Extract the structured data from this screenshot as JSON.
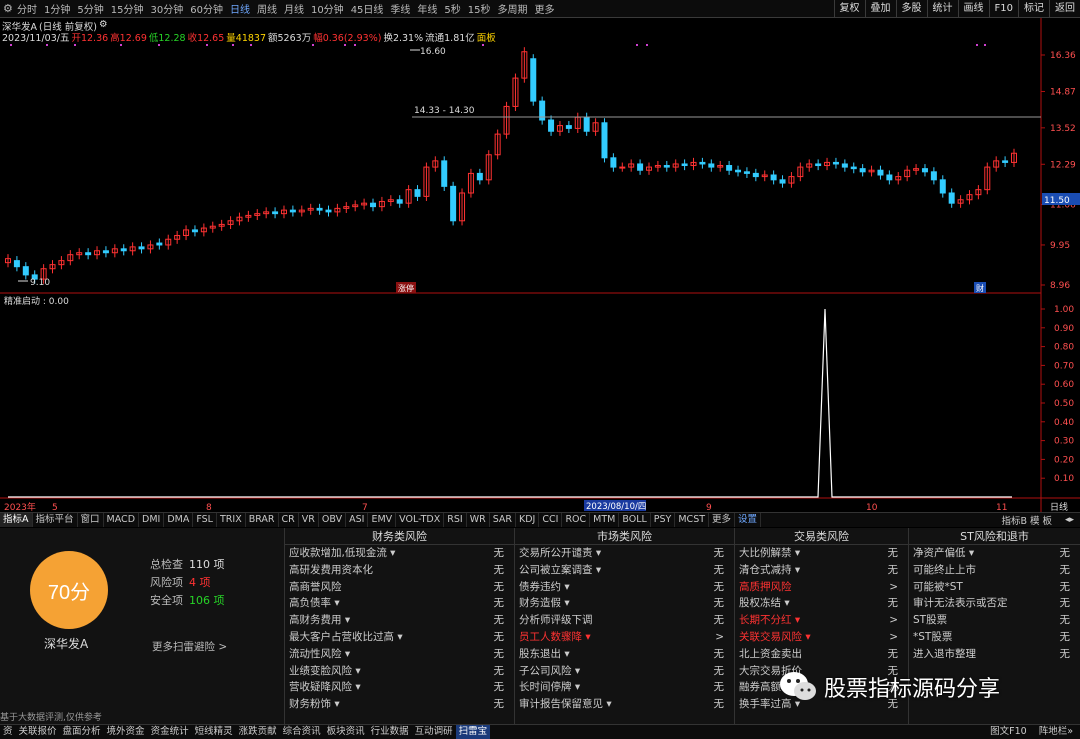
{
  "topbar": {
    "periods": [
      "分时",
      "1分钟",
      "5分钟",
      "15分钟",
      "30分钟",
      "60分钟",
      "日线",
      "周线",
      "月线",
      "10分钟",
      "45日线",
      "季线",
      "年线",
      "5秒",
      "15秒",
      "多周期",
      "更多"
    ],
    "active": "日线",
    "right_buttons": [
      "复权",
      "叠加",
      "多股",
      "统计",
      "画线",
      "F10",
      "标记",
      "返回"
    ]
  },
  "info": {
    "stock": "深华发A",
    "mode": "(日线 前复权)",
    "date": "2023/11/03/五",
    "open": "开12.36",
    "high": "高12.69",
    "low": "低12.28",
    "close": "收12.65",
    "volume": "量41837",
    "amount": "额5263万",
    "change": "幅0.36(2.93%)",
    "turnover": "换2.31%",
    "float": "流通1.81亿",
    "panel": "面板"
  },
  "price_axis": [
    "16.36",
    "14.87",
    "13.52",
    "12.29",
    "11.06",
    "9.95",
    "8.96"
  ],
  "current_price_tag": "11.50",
  "annotations": {
    "peak": "16.60",
    "range": "14.33 - 14.30",
    "low": "9.10",
    "tag_mid": "涨停",
    "tag_right": "财"
  },
  "indicator": {
    "title": "精准启动 : 0.00",
    "axis": [
      "1.00",
      "0.90",
      "0.80",
      "0.70",
      "0.60",
      "0.50",
      "0.40",
      "0.30",
      "0.20",
      "0.10"
    ]
  },
  "time_axis": {
    "labels": [
      "2023年",
      "5",
      "8",
      "7",
      "9",
      "10",
      "11"
    ],
    "cursor_date": "2023/08/10/四",
    "right": "日线"
  },
  "indicator_tabs": [
    "指标A",
    "指标平台",
    "窗口",
    "MACD",
    "DMI",
    "DMA",
    "FSL",
    "TRIX",
    "BRAR",
    "CR",
    "VR",
    "OBV",
    "ASI",
    "EMV",
    "VOL-TDX",
    "RSI",
    "WR",
    "SAR",
    "KDJ",
    "CCI",
    "ROC",
    "MTM",
    "BOLL",
    "PSY",
    "MCST",
    "更多",
    "设置"
  ],
  "indicator_tabs_right": "指标B 模 板",
  "risk": {
    "score": "70分",
    "name": "深华发A",
    "total_label": "总检查",
    "total_value": "110 项",
    "risk_label": "风险项",
    "risk_value": "4 项",
    "safe_label": "安全项",
    "safe_value": "106 项",
    "more": "更多扫雷避险 >",
    "columns": [
      {
        "title": "财务类风险",
        "rows": [
          {
            "name": "应收款增加,低现金流 ▾",
            "value": "无",
            "hl": false
          },
          {
            "name": "高研发费用资本化",
            "value": "无",
            "hl": false
          },
          {
            "name": "高商誉风险",
            "value": "无",
            "hl": false
          },
          {
            "name": "高负债率 ▾",
            "value": "无",
            "hl": false
          },
          {
            "name": "高财务费用 ▾",
            "value": "无",
            "hl": false
          },
          {
            "name": "最大客户占营收比过高 ▾",
            "value": "无",
            "hl": false
          },
          {
            "name": "流动性风险 ▾",
            "value": "无",
            "hl": false
          },
          {
            "name": "业绩变脸风险 ▾",
            "value": "无",
            "hl": false
          },
          {
            "name": "营收疑降风险 ▾",
            "value": "无",
            "hl": false
          },
          {
            "name": "财务粉饰 ▾",
            "value": "无",
            "hl": false
          }
        ]
      },
      {
        "title": "市场类风险",
        "rows": [
          {
            "name": "交易所公开谴责 ▾",
            "value": "无",
            "hl": false
          },
          {
            "name": "公司被立案调查 ▾",
            "value": "无",
            "hl": false
          },
          {
            "name": "债券违约 ▾",
            "value": "无",
            "hl": false
          },
          {
            "name": "财务造假 ▾",
            "value": "无",
            "hl": false
          },
          {
            "name": "分析师评级下调",
            "value": "无",
            "hl": false
          },
          {
            "name": "员工人数骤降 ▾",
            "value": ">",
            "hl": true
          },
          {
            "name": "股东退出 ▾",
            "value": "无",
            "hl": false
          },
          {
            "name": "子公司风险 ▾",
            "value": "无",
            "hl": false
          },
          {
            "name": "长时间停牌 ▾",
            "value": "无",
            "hl": false
          },
          {
            "name": "审计报告保留意见 ▾",
            "value": "无",
            "hl": false
          }
        ]
      },
      {
        "title": "交易类风险",
        "rows": [
          {
            "name": "大比例解禁 ▾",
            "value": "无",
            "hl": false
          },
          {
            "name": "清仓式减持 ▾",
            "value": "无",
            "hl": false
          },
          {
            "name": "高质押风险",
            "value": ">",
            "hl": true
          },
          {
            "name": "股权冻结 ▾",
            "value": "无",
            "hl": false
          },
          {
            "name": "长期不分红 ▾",
            "value": ">",
            "hl": true
          },
          {
            "name": "关联交易风险 ▾",
            "value": ">",
            "hl": true
          },
          {
            "name": "北上资金卖出",
            "value": "无",
            "hl": false
          },
          {
            "name": "大宗交易折价",
            "value": "无",
            "hl": false
          },
          {
            "name": "融券高额",
            "value": "无",
            "hl": false
          },
          {
            "name": "换手率过高 ▾",
            "value": "无",
            "hl": false
          }
        ]
      },
      {
        "title": "ST风险和退市",
        "rows": [
          {
            "name": "净资产偏低 ▾",
            "value": "无",
            "hl": false
          },
          {
            "name": "可能终止上市",
            "value": "无",
            "hl": false
          },
          {
            "name": "可能被*ST",
            "value": "无",
            "hl": false
          },
          {
            "name": "审计无法表示或否定",
            "value": "无",
            "hl": false
          },
          {
            "name": "ST股票",
            "value": "无",
            "hl": false
          },
          {
            "name": "*ST股票",
            "value": "无",
            "hl": false
          },
          {
            "name": "进入退市整理",
            "value": "无",
            "hl": false
          }
        ]
      }
    ]
  },
  "watermark": "股票指标源码分享",
  "disclaimer": "基于大数据评测,仅供参考",
  "bottom_tabs": [
    "资",
    "关联报价",
    "盘面分析",
    "境外资金",
    "资金统计",
    "短线精灵",
    "涨跌贡献",
    "综合资讯",
    "板块资讯",
    "行业数据",
    "互动调研",
    "扫雷宝"
  ],
  "bottom_active": "扫雷宝",
  "bottom_right": [
    "图文F10",
    "阵地栏»"
  ],
  "colors": {
    "up": "#ff3232",
    "down": "#3cf",
    "accent": "#f5a234",
    "link": "#6fa8ff"
  }
}
